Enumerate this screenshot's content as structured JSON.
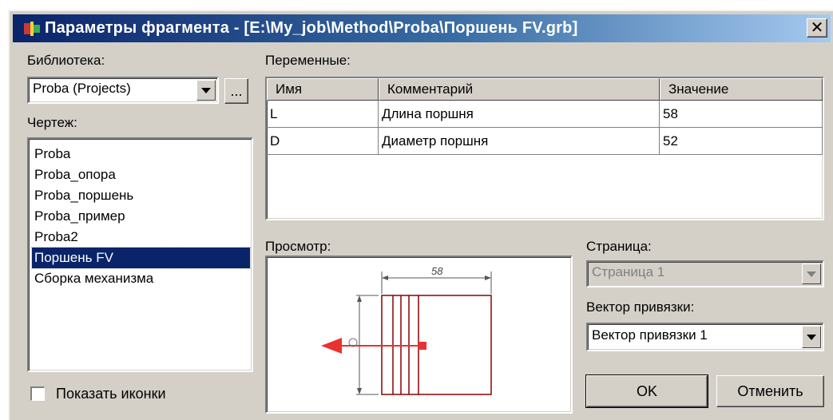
{
  "window": {
    "title": "Параметры фрагмента - [E:\\My_job\\Method\\Proba\\Поршень FV.grb]",
    "close_glyph": "✕"
  },
  "library": {
    "label": "Библиотека:",
    "selected": "Proba (Projects)",
    "browse_label": "..."
  },
  "drawing": {
    "label": "Чертеж:",
    "items": [
      "Proba",
      "Proba_опора",
      "Proba_поршень",
      "Proba_пример",
      "Proba2",
      "Поршень FV",
      "Сборка механизма"
    ],
    "selected_index": 5
  },
  "show_icons": {
    "label": "Показать иконки",
    "checked": false
  },
  "variables": {
    "label": "Переменные:",
    "columns": [
      "Имя",
      "Комментарий",
      "Значение"
    ],
    "rows": [
      {
        "name": "L",
        "comment": "Длина поршня",
        "value": "58"
      },
      {
        "name": "D",
        "comment": "Диаметр поршня",
        "value": "52"
      }
    ]
  },
  "preview": {
    "label": "Просмотр:",
    "dimension_text": "58"
  },
  "page": {
    "label": "Страница:",
    "selected": "Страница 1",
    "disabled": true
  },
  "anchor_vector": {
    "label": "Вектор привязки:",
    "selected": "Вектор привязки 1"
  },
  "buttons": {
    "ok": "OK",
    "cancel": "Отменить"
  },
  "colors": {
    "face": "#d4d0c8",
    "title_start": "#0a246a",
    "title_end": "#a6caf0",
    "selection": "#0a246a",
    "drawing_line": "#8b0000",
    "anchor_arrow": "#e8322f",
    "disabled_text": "#808080"
  }
}
